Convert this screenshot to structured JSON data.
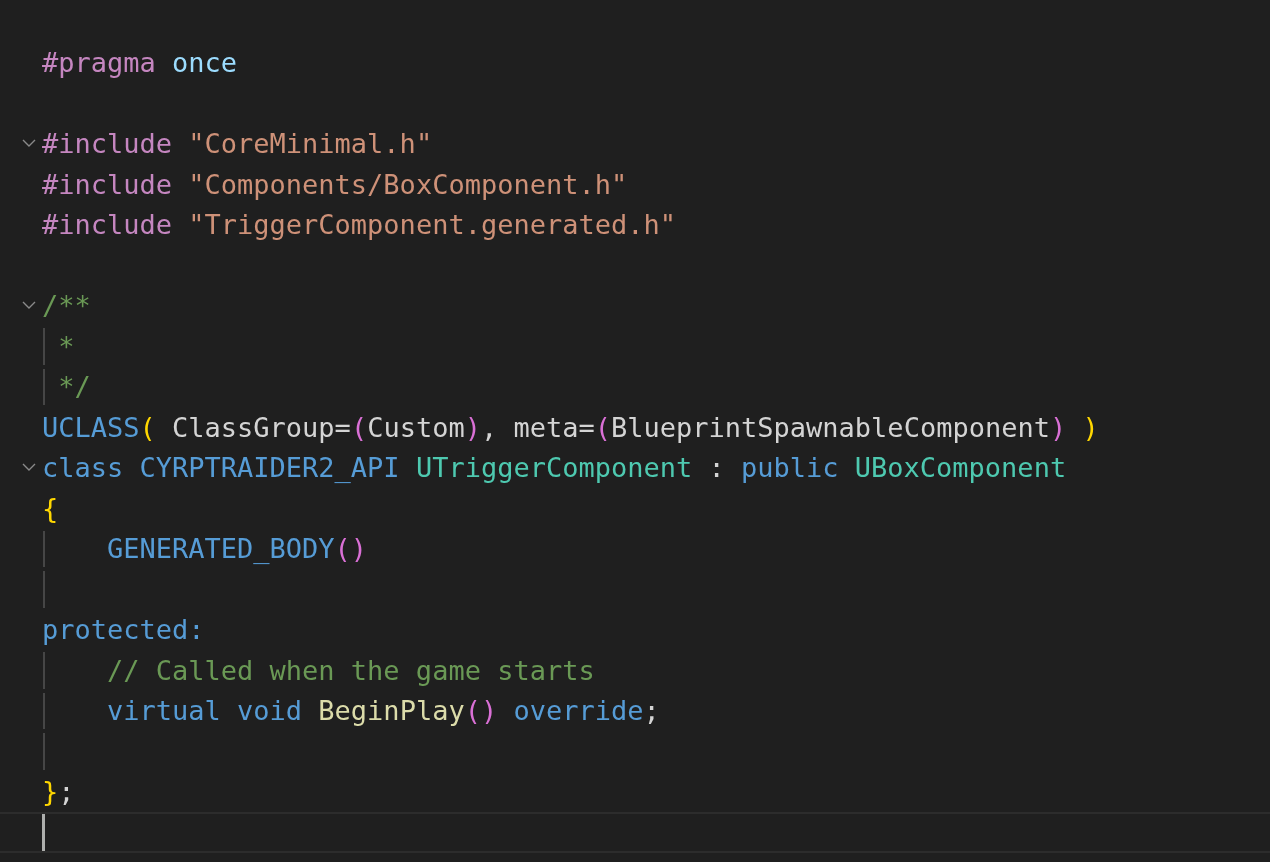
{
  "editor": {
    "lines": [
      {
        "guide": false
      },
      {
        "tokens": [
          {
            "text": "#pragma",
            "kind": "pp"
          },
          {
            "text": " once",
            "kind": "var"
          }
        ]
      },
      {
        "guide": false
      },
      {
        "fold": true,
        "tokens": [
          {
            "text": "#include",
            "kind": "pp"
          },
          {
            "text": " \"CoreMinimal.h\"",
            "kind": "str"
          }
        ]
      },
      {
        "tokens": [
          {
            "text": "#include",
            "kind": "pp"
          },
          {
            "text": " \"Components/BoxComponent.h\"",
            "kind": "str"
          }
        ]
      },
      {
        "tokens": [
          {
            "text": "#include",
            "kind": "pp"
          },
          {
            "text": " \"TriggerComponent.generated.h\"",
            "kind": "str"
          }
        ]
      },
      {
        "guide": false
      },
      {
        "fold": true,
        "tokens": [
          {
            "text": "/**",
            "kind": "cmt"
          }
        ]
      },
      {
        "guide": true,
        "tokens": [
          {
            "text": " *",
            "kind": "cmt"
          }
        ]
      },
      {
        "guide": true,
        "tokens": [
          {
            "text": " */",
            "kind": "cmt"
          }
        ]
      },
      {
        "tokens": [
          {
            "text": "UCLASS",
            "kind": "kw"
          },
          {
            "text": "(",
            "kind": "br1"
          },
          {
            "text": " ClassGroup="
          },
          {
            "text": "(",
            "kind": "br2"
          },
          {
            "text": "Custom"
          },
          {
            "text": ")",
            "kind": "br2"
          },
          {
            "text": ", meta="
          },
          {
            "text": "(",
            "kind": "br2"
          },
          {
            "text": "BlueprintSpawnableComponent"
          },
          {
            "text": ")",
            "kind": "br2"
          },
          {
            "text": " )",
            "kind": "br1"
          }
        ]
      },
      {
        "fold": true,
        "tokens": [
          {
            "text": "class",
            "kind": "kw"
          },
          {
            "text": " CYRPTRAIDER2_API",
            "kind": "kw"
          },
          {
            "text": " UTriggerComponent",
            "kind": "type"
          },
          {
            "text": " : "
          },
          {
            "text": "public",
            "kind": "kw"
          },
          {
            "text": " UBoxComponent",
            "kind": "type"
          }
        ]
      },
      {
        "tokens": [
          {
            "text": "{",
            "kind": "br1"
          }
        ]
      },
      {
        "guide": true,
        "tokens": [
          {
            "text": "    GENERATED_BODY",
            "kind": "kw"
          },
          {
            "text": "()",
            "kind": "br2"
          }
        ]
      },
      {
        "guide": true
      },
      {
        "tokens": [
          {
            "text": "protected:",
            "kind": "kw"
          }
        ]
      },
      {
        "guide": true,
        "tokens": [
          {
            "text": "    // Called when the game starts",
            "kind": "cmt"
          }
        ]
      },
      {
        "guide": true,
        "tokens": [
          {
            "text": "    virtual",
            "kind": "kw"
          },
          {
            "text": " void",
            "kind": "kw"
          },
          {
            "text": " BeginPlay",
            "kind": "fn"
          },
          {
            "text": "()",
            "kind": "br2"
          },
          {
            "text": " override",
            "kind": "kw"
          },
          {
            "text": ";"
          }
        ]
      },
      {
        "guide": true
      },
      {
        "tokens": [
          {
            "text": "}",
            "kind": "br1"
          },
          {
            "text": ";"
          }
        ]
      },
      {
        "current": true
      }
    ]
  }
}
